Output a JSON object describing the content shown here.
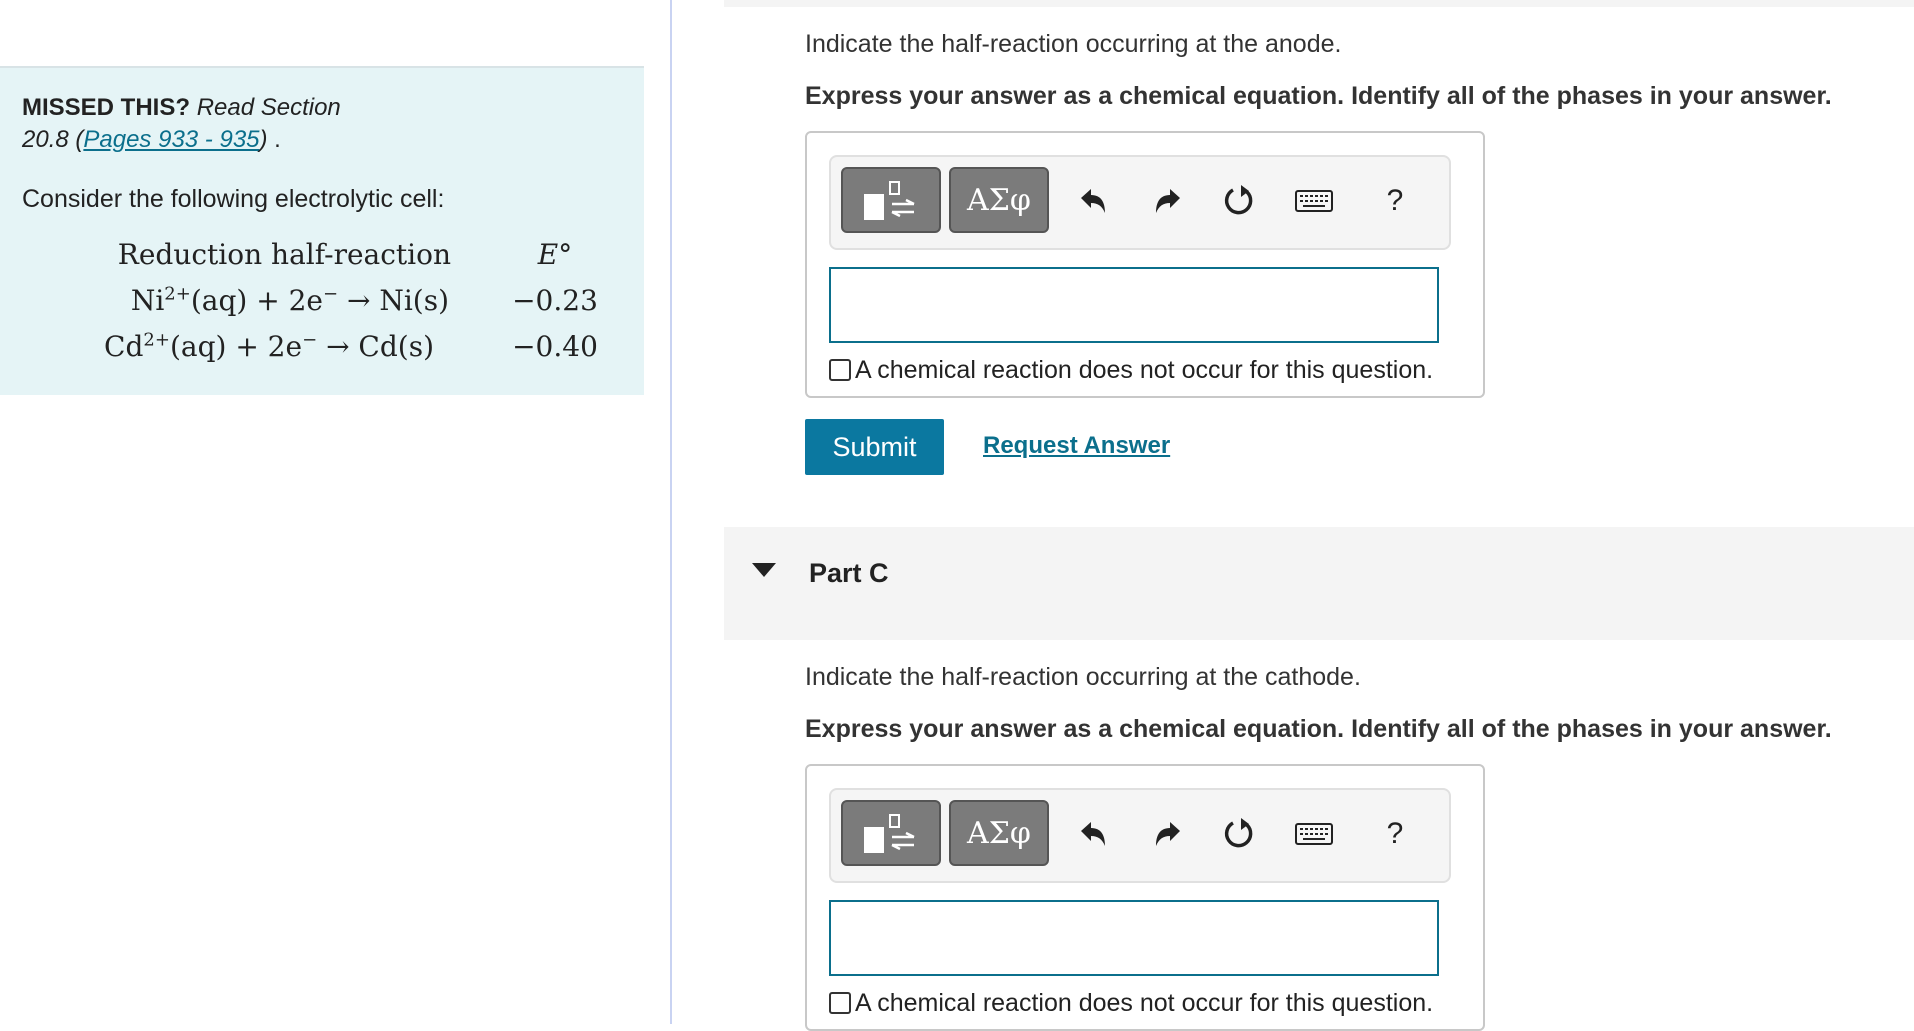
{
  "left": {
    "missed_bold": "MISSED THIS?",
    "missed_italic_1": "Read Section",
    "missed_italic_2": "20.8 (",
    "missed_link": "Pages 933 - 935",
    "missed_italic_3": ")",
    "missed_tail": " .",
    "consider": "Consider the following electrolytic cell:",
    "table": {
      "col1_header": "Reduction half-reaction",
      "col2_header": "E°",
      "rows": [
        {
          "pre": "Ni",
          "sup": "2+",
          "post": "(aq) + 2e",
          "sup2": "−",
          "tail": " → Ni(s)",
          "e": "−0.23"
        },
        {
          "pre": "Cd",
          "sup": "2+",
          "post": "(aq) + 2e",
          "sup2": "−",
          "tail": " → Cd(s)",
          "e": "−0.40"
        }
      ]
    }
  },
  "partB": {
    "prompt": "Indicate the half-reaction occurring at the anode.",
    "instruction": "Express your answer as a chemical equation. Identify all of the phases in your answer.",
    "input_value": "",
    "no_reaction_label": "A chemical reaction does not occur for this question.",
    "submit_label": "Submit",
    "request_label": "Request Answer"
  },
  "toolbar": {
    "greek_label": "ΑΣφ",
    "help_label": "?",
    "icons": [
      "templates-icon",
      "greek-letters-icon",
      "undo-icon",
      "redo-icon",
      "reset-icon",
      "keyboard-icon",
      "help-icon"
    ]
  },
  "partC": {
    "title": "Part C",
    "prompt": "Indicate the half-reaction occurring at the cathode.",
    "instruction": "Express your answer as a chemical equation. Identify all of the phases in your answer.",
    "input_value": "",
    "no_reaction_label": "A chemical reaction does not occur for this question."
  },
  "colors": {
    "accent": "#0b78a0",
    "link": "#0b6f8c",
    "panel_bg": "#e5f4f6"
  }
}
